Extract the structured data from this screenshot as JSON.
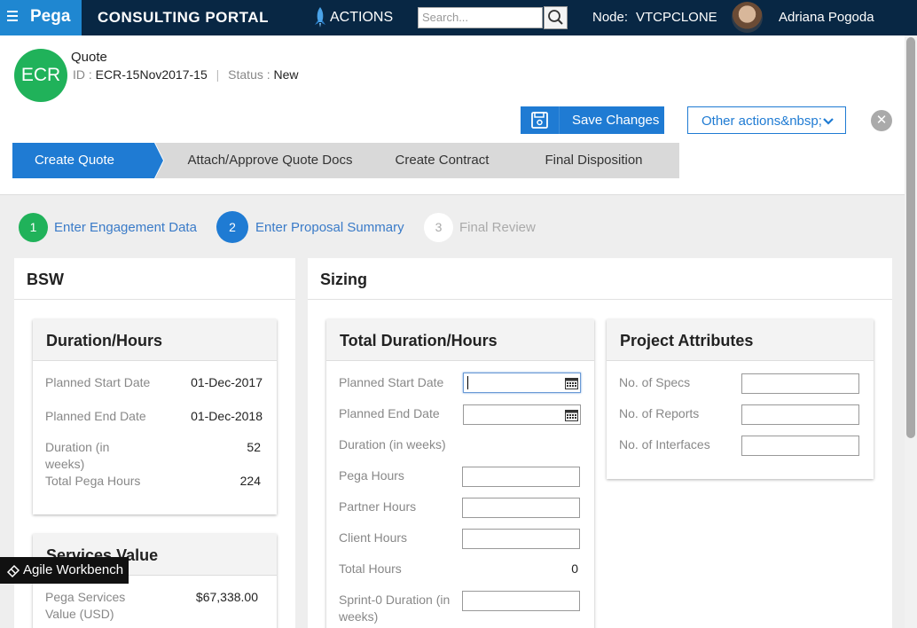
{
  "topbar": {
    "logo": "Pega",
    "portal_title": "CONSULTING PORTAL",
    "actions_label": "ACTIONS",
    "search_placeholder": "Search...",
    "node_label": "Node:",
    "node_value": "VTCPCLONE",
    "user_name": "Adriana Pogoda"
  },
  "case": {
    "initials": "ECR",
    "title": "Quote",
    "id_label": "ID :",
    "id_value": "ECR-15Nov2017-15",
    "status_label": "Status :",
    "status_value": "New",
    "save_label": "Save Changes",
    "other_actions_label": "Other actions&nbsp;"
  },
  "stages": [
    {
      "label": "Create Quote",
      "active": true
    },
    {
      "label": "Attach/Approve Quote Docs",
      "active": false
    },
    {
      "label": "Create Contract",
      "active": false
    },
    {
      "label": "Final Disposition",
      "active": false
    }
  ],
  "steps": [
    {
      "num": "1",
      "label": "Enter Engagement Data",
      "state": "complete"
    },
    {
      "num": "2",
      "label": "Enter Proposal Summary",
      "state": "current"
    },
    {
      "num": "3",
      "label": "Final Review",
      "state": "pending"
    }
  ],
  "bsw": {
    "title": "BSW",
    "duration_card": {
      "title": "Duration/Hours",
      "rows": [
        {
          "label": "Planned Start Date",
          "value": "01-Dec-2017"
        },
        {
          "label": "Planned End Date",
          "value": "01-Dec-2018"
        },
        {
          "label": "Duration (in weeks)",
          "value": "52"
        },
        {
          "label": "Total Pega Hours",
          "value": "224"
        }
      ]
    },
    "services_card": {
      "title": "Services Value",
      "rows": [
        {
          "label": "Pega Services Value (USD)",
          "value": "$67,338.00"
        }
      ]
    }
  },
  "sizing": {
    "title": "Sizing",
    "total_card": {
      "title": "Total Duration/Hours",
      "planned_start_label": "Planned Start Date",
      "planned_end_label": "Planned End Date",
      "duration_label": "Duration (in weeks)",
      "pega_hours_label": "Pega Hours",
      "partner_hours_label": "Partner Hours",
      "client_hours_label": "Client Hours",
      "total_hours_label": "Total Hours",
      "total_hours_value": "0",
      "sprint0_label": "Sprint-0 Duration (in weeks)"
    },
    "project_card": {
      "title": "Project Attributes",
      "specs_label": "No. of Specs",
      "reports_label": "No. of Reports",
      "interfaces_label": "No. of Interfaces"
    }
  },
  "agile_badge": "Agile Workbench",
  "colors": {
    "topbar_bg": "#082744",
    "brand_blue": "#1f87d1",
    "accent_blue": "#1f7bd3",
    "success_green": "#20b25a"
  }
}
